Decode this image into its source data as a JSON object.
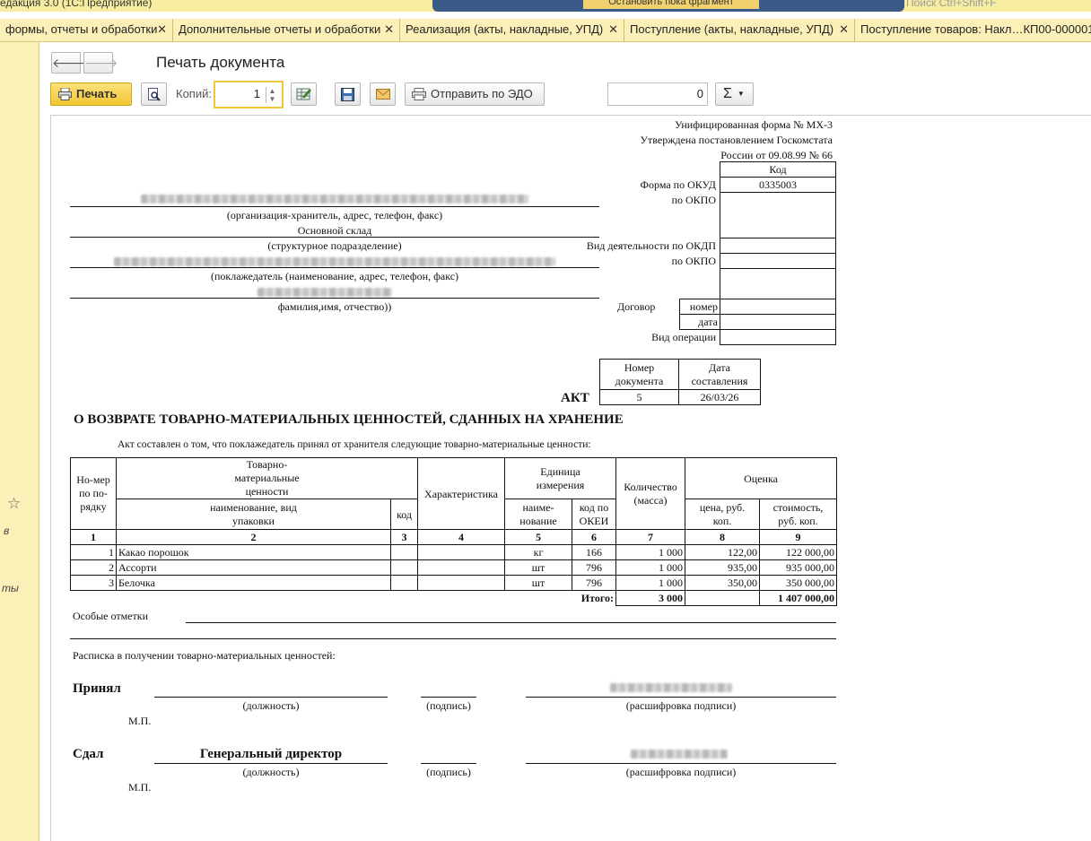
{
  "window": {
    "app_title": "едакция 3.0 (1С:Предприятие)",
    "center_title": "Остановить пока фрагмент",
    "search_placeholder": "Поиск Ctrl+Shift+F"
  },
  "tabs": [
    {
      "label": "формы, отчеты и обработки"
    },
    {
      "label": "Дополнительные отчеты и обработки"
    },
    {
      "label": "Реализация (акты, накладные, УПД)"
    },
    {
      "label": "Поступление (акты, накладные, УПД)"
    },
    {
      "label": "Поступление товаров: Накл…КП00-000001"
    }
  ],
  "leftpanel": {
    "text1": "в",
    "text2": "ты"
  },
  "toolbar": {
    "page_title": "Печать документа",
    "print_label": "Печать",
    "copies_label": "Копий:",
    "copies_value": "1",
    "send_edo_label": "Отправить по ЭДО",
    "sum_value": "0",
    "sum_symbol": "Σ"
  },
  "form": {
    "header_line1": "Унифицированная форма № МХ-3",
    "header_line2": "Утверждена постановлением Госкомстата",
    "header_line3": "России от 09.08.99 № 66",
    "code_header": "Код",
    "okud_label": "Форма по ОКУД",
    "okud_code": "0335003",
    "okpo_label": "по ОКПО",
    "org_caption": "(организация-хранитель, адрес, телефон, факс)",
    "warehouse": "Основной склад",
    "division_caption": "(структурное подразделение)",
    "okdp_label": "Вид деятельности по ОКДП",
    "okpo2_label": "по ОКПО",
    "depositor_caption": "(поклажедатель (наименование, адрес, телефон, факс)",
    "fio_caption": "фамилия,имя, отчество))",
    "contract_label": "Договор",
    "number_label": "номер",
    "date_label": "дата",
    "operation_label": "Вид операции",
    "docnum_header": "Номер документа",
    "docdate_header": "Дата составления",
    "doc_number": "5",
    "doc_date": "26/03/26",
    "act_word": "АКТ",
    "act_title": "О ВОЗВРАТЕ ТОВАРНО-МАТЕРИАЛЬНЫХ ЦЕННОСТЕЙ, СДАННЫХ НА ХРАНЕНИЕ",
    "act_intro": "Акт составлен о том, что поклажедатель принял от хранителя следующие товарно-материальные ценности:",
    "special_marks": "Особые отметки",
    "receipt": "Расписка в получении товарно-материальных ценностей:",
    "accepted": "Принял",
    "handed": "Сдал",
    "position_caption": "(должность)",
    "signature_caption": "(подпись)",
    "decode_caption": "(расшифровка подписи)",
    "mp": "М.П.",
    "handed_position": "Генеральный директор"
  },
  "table": {
    "h_num": "Но-мер по по-рядку",
    "h_goods": "Товарно-материальные ценности",
    "h_name": "наименование, вид упаковки",
    "h_code": "код",
    "h_char": "Характеристика",
    "h_unit": "Единица измерения",
    "h_unit_name": "наиме-нование",
    "h_unit_code": "код по ОКЕИ",
    "h_qty": "Количество (масса)",
    "h_est": "Оценка",
    "h_price": "цена, руб. коп.",
    "h_cost": "стоимость, руб. коп.",
    "colnums": [
      "1",
      "2",
      "3",
      "4",
      "5",
      "6",
      "7",
      "8",
      "9"
    ],
    "rows": [
      {
        "n": "1",
        "name": "Какао порошок",
        "code": "",
        "char": "",
        "unit": "кг",
        "okei": "166",
        "qty": "1 000",
        "price": "122,00",
        "cost": "122 000,00"
      },
      {
        "n": "2",
        "name": "Ассорти",
        "code": "",
        "char": "",
        "unit": "шт",
        "okei": "796",
        "qty": "1 000",
        "price": "935,00",
        "cost": "935 000,00"
      },
      {
        "n": "3",
        "name": "Белочка",
        "code": "",
        "char": "",
        "unit": "шт",
        "okei": "796",
        "qty": "1 000",
        "price": "350,00",
        "cost": "350 000,00"
      }
    ],
    "total_label": "Итого:",
    "total_qty": "3 000",
    "total_cost": "1 407 000,00"
  },
  "colors": {
    "panel": "#fbf0b7",
    "print_button": "#f3c631",
    "focus": "#f0c93a"
  }
}
